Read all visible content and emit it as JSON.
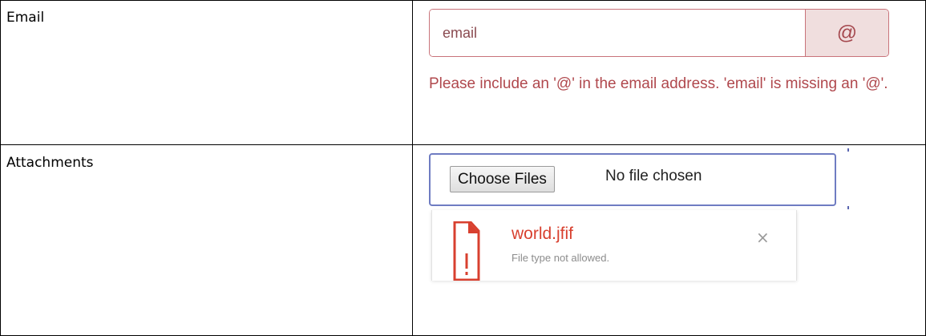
{
  "rows": [
    {
      "label": "Email"
    },
    {
      "label": "Attachments"
    }
  ],
  "email": {
    "value": "email",
    "addon": "@",
    "error": "Please include an '@' in the email address. 'email' is missing an '@'."
  },
  "attachments": {
    "button_label": "Choose Files",
    "status": "No file chosen",
    "files": [
      {
        "name": "world.jfif",
        "message": "File type not allowed.",
        "icon": "file-error-icon",
        "remove": "×"
      }
    ]
  },
  "colors": {
    "error_text": "#b0484d",
    "error_border": "#c9737a",
    "addon_bg": "#f0dede",
    "focus_border": "#6f7cc2",
    "file_error": "#d8402f"
  }
}
